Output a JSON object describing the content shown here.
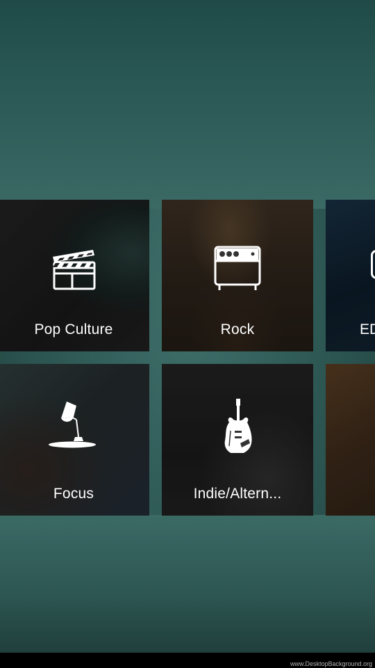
{
  "categories": [
    {
      "id": "pop-culture",
      "label": "Pop Culture",
      "icon": "clapperboard-icon"
    },
    {
      "id": "rock",
      "label": "Rock",
      "icon": "amplifier-icon"
    },
    {
      "id": "edm",
      "label": "ED",
      "icon": "partial-icon"
    },
    {
      "id": "focus",
      "label": "Focus",
      "icon": "desk-lamp-icon"
    },
    {
      "id": "indie-alternative",
      "label": "Indie/Altern...",
      "icon": "electric-guitar-icon"
    },
    {
      "id": "partial-tile",
      "label": "",
      "icon": ""
    }
  ],
  "watermark": "www.DesktopBackground.org",
  "colors": {
    "background": "#2f5a56",
    "tile_text": "#ffffff",
    "nav_bar": "#000000"
  }
}
